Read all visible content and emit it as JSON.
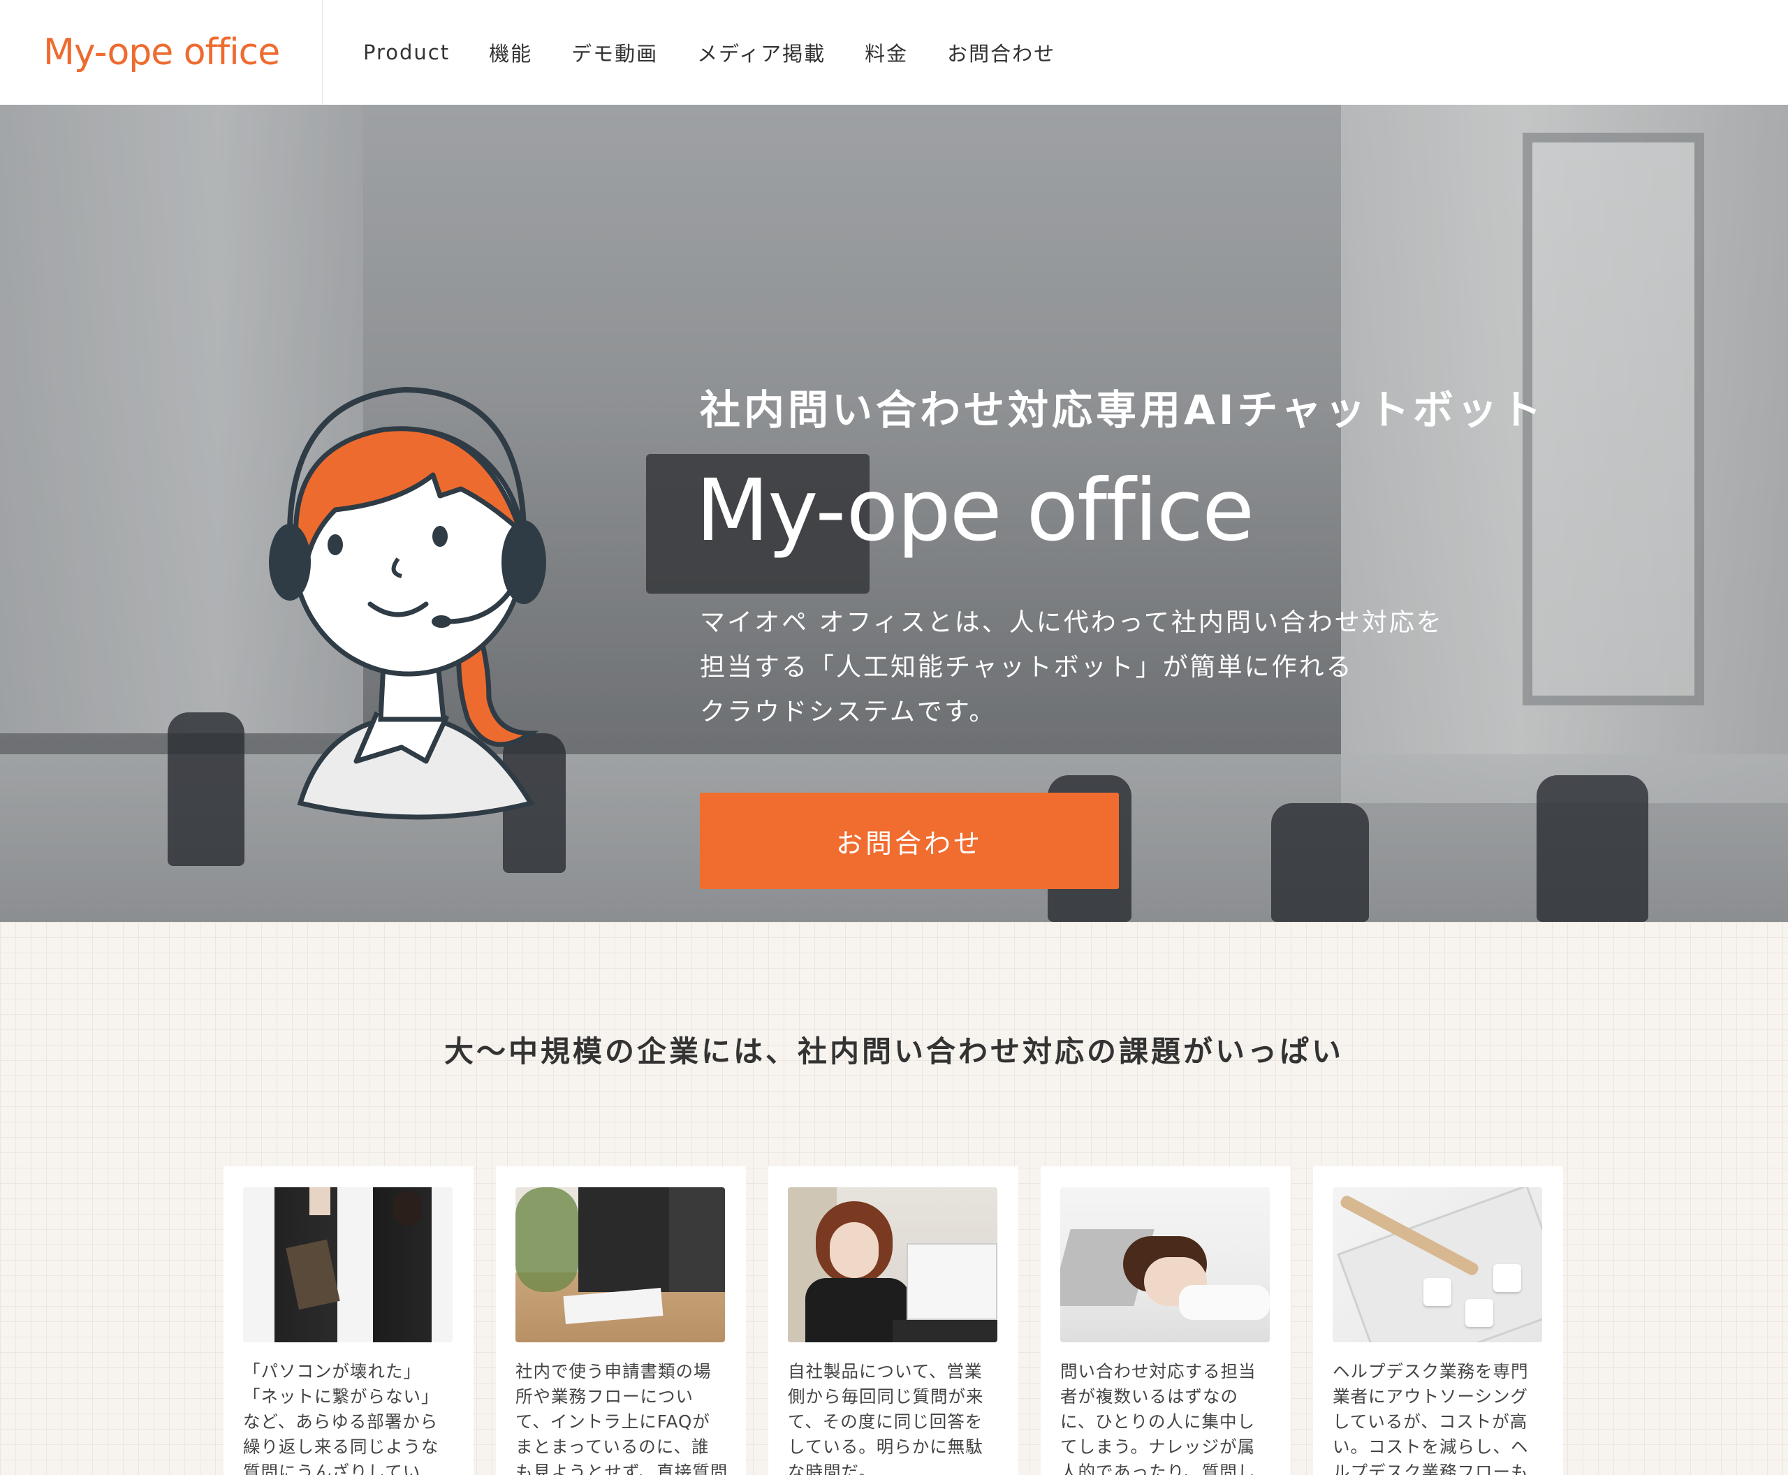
{
  "header": {
    "logo": "My-ope office",
    "nav": [
      "Product",
      "機能",
      "デモ動画",
      "メディア掲載",
      "料金",
      "お問合わせ"
    ]
  },
  "hero": {
    "subtitle": "社内問い合わせ対応専用AIチャットボット",
    "title": "My-ope office",
    "description": [
      "マイオペ オフィスとは、人に代わって社内問い合わせ対応を",
      "担当する「人工知能チャットボット」が簡単に作れる",
      "クラウドシステムです。"
    ],
    "cta_label": "お問合わせ"
  },
  "problems": {
    "title": "大〜中規模の企業には、社内問い合わせ対応の課題がいっぱい",
    "cards": [
      {
        "lines": [
          "「パソコンが壊れた」",
          "「ネットに繋がらない」",
          "など、あらゆる部署から",
          "繰り返し来る同じような",
          "質問にうんざりしてい"
        ]
      },
      {
        "lines": [
          "社内で使う申請書類の場",
          "所や業務フローについ",
          "て、イントラ上にFAQが",
          "まとまっているのに、誰",
          "も見ようとせず、直接質問"
        ]
      },
      {
        "lines": [
          "自社製品について、営業",
          "側から毎回同じ質問が来",
          "て、その度に同じ回答を",
          "している。明らかに無駄",
          "な時間だ。"
        ]
      },
      {
        "lines": [
          "問い合わせ対応する担当",
          "者が複数いるはずなの",
          "に、ひとりの人に集中し",
          "てしまう。ナレッジが属",
          "人的であったり、質問し"
        ]
      },
      {
        "lines": [
          "ヘルプデスク業務を専門",
          "業者にアウトソーシング",
          "しているが、コストが高",
          "い。コストを減らし、ヘ",
          "ルプデスク業務フローも"
        ]
      }
    ]
  },
  "colors": {
    "accent": "#f06c2f",
    "brand": "#ee6b2f",
    "section_bg": "#f7f3ee"
  }
}
